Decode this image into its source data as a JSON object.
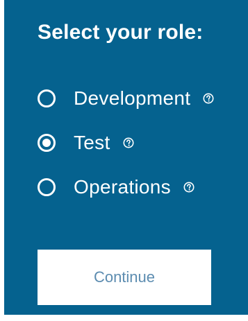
{
  "title": "Select your role:",
  "roles": [
    {
      "label": "Development",
      "selected": false
    },
    {
      "label": "Test",
      "selected": true
    },
    {
      "label": "Operations",
      "selected": false
    }
  ],
  "continue_label": "Continue",
  "colors": {
    "panel_background": "#05628f",
    "text": "#ffffff",
    "button_background": "#ffffff",
    "button_text": "#5c8cb0"
  },
  "icons": {
    "help": "question-circle-icon",
    "radio": "radio-button"
  }
}
